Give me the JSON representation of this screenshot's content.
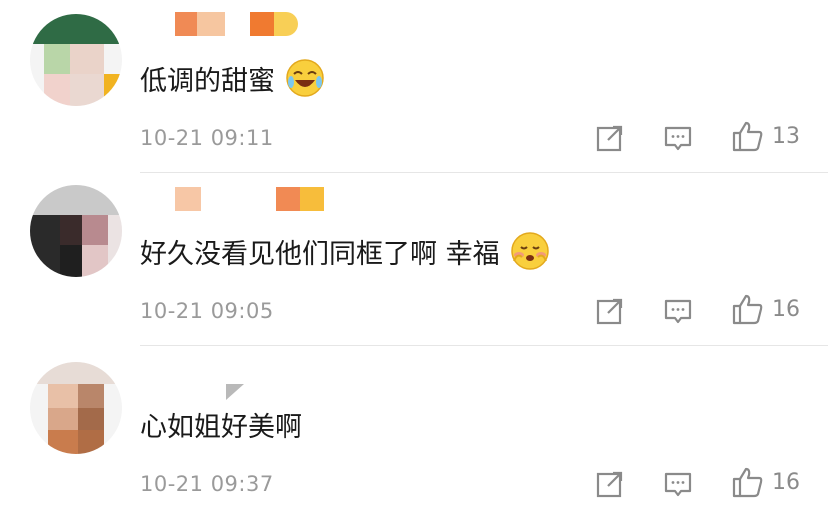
{
  "comments": [
    {
      "text": "低调的甜蜜",
      "time": "10-21 09:11",
      "likes": "13",
      "emoji": "laugh-cry-emoji"
    },
    {
      "text": "好久没看见他们同框了啊 幸福",
      "time": "10-21 09:05",
      "likes": "16",
      "emoji": "blush-emoji"
    },
    {
      "text": "心如姐好美啊",
      "time": "10-21 09:37",
      "likes": "16",
      "emoji": ""
    }
  ],
  "colors": {
    "text": "#1a1a1a",
    "meta": "#9a9a9a",
    "icon": "#8a8a8a",
    "divider": "#e6e6e6",
    "name_blur_orange": "#f29a5f",
    "name_blur_yellow": "#f7c64a"
  },
  "icons": [
    "share-icon",
    "comment-icon",
    "thumb-up-icon"
  ]
}
